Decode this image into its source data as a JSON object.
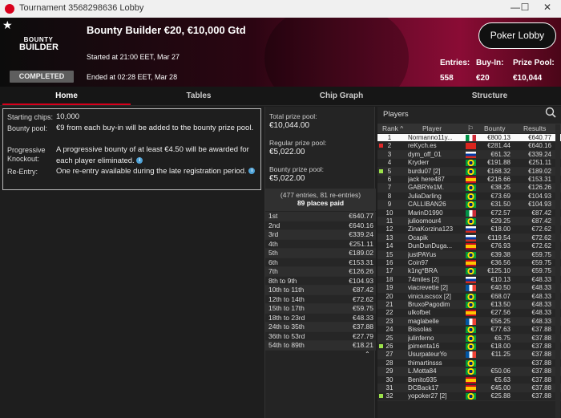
{
  "window": {
    "title": "Tournament 3568298636 Lobby",
    "controls": [
      "—",
      "☐",
      "✕"
    ]
  },
  "header": {
    "logo_line1": "BOUNTY",
    "logo_line2": "BUILDER",
    "title": "Bounty Builder €20, €10,000 Gtd",
    "started": "Started at 21:00 EET, Mar 27",
    "ended": "Ended at 02:28 EET, Mar 28",
    "status": "COMPLETED",
    "lobby_button": "Poker Lobby",
    "entries_label": "Entries:",
    "entries_value": "558",
    "buyin_label": "Buy-In:",
    "buyin_value": "€20",
    "prizepool_label": "Prize Pool:",
    "prizepool_value": "€10,044"
  },
  "tabs": [
    {
      "label": "Home",
      "active": true
    },
    {
      "label": "Tables",
      "active": false
    },
    {
      "label": "Chip Graph",
      "active": false
    },
    {
      "label": "Structure",
      "active": false
    }
  ],
  "info": {
    "chips_label": "Starting chips:",
    "chips_value": "10,000",
    "bounty_label": "Bounty pool:",
    "bounty_value": "€9 from each buy-in will be added to the bounty prize pool.",
    "prog_label1": "Progressive",
    "prog_label2": "Knockout:",
    "prog_value": "A progressive bounty of at least €4.50 will be awarded for each player eliminated.",
    "reentry_label": "Re-Entry:",
    "reentry_value": "One re-entry available during the late registration period."
  },
  "prize": {
    "total_label": "Total prize pool:",
    "total_value": "€10,044.00",
    "regular_label": "Regular prize pool:",
    "regular_value": "€5,022.00",
    "bounty_label": "Bounty prize pool:",
    "bounty_value": "€5,022.00",
    "entries_note": "(477 entries, 81 re-entries)",
    "places_paid": "89 places paid",
    "payouts": [
      {
        "place": "1st",
        "amount": "€640.77"
      },
      {
        "place": "2nd",
        "amount": "€640.16"
      },
      {
        "place": "3rd",
        "amount": "€339.24"
      },
      {
        "place": "4th",
        "amount": "€251.11"
      },
      {
        "place": "5th",
        "amount": "€189.02"
      },
      {
        "place": "6th",
        "amount": "€153.31"
      },
      {
        "place": "7th",
        "amount": "€126.26"
      },
      {
        "place": "8th to 9th",
        "amount": "€104.93"
      },
      {
        "place": "10th to 11th",
        "amount": "€87.42"
      },
      {
        "place": "12th to 14th",
        "amount": "€72.62"
      },
      {
        "place": "15th to 17th",
        "amount": "€59.75"
      },
      {
        "place": "18th to 23rd",
        "amount": "€48.33"
      },
      {
        "place": "24th to 35th",
        "amount": "€37.88"
      },
      {
        "place": "36th to 53rd",
        "amount": "€27.79"
      },
      {
        "place": "54th to 89th",
        "amount": "€18.21"
      }
    ]
  },
  "players": {
    "heading": "Players",
    "columns": {
      "rank": "Rank",
      "player": "Player",
      "bounty": "Bounty",
      "results": "Results"
    },
    "rows": [
      {
        "rank": "1",
        "name": "Normanno11y...",
        "flag": "flag-italy",
        "bounty": "€800.13",
        "result": "€640.77",
        "marker": "none"
      },
      {
        "rank": "2",
        "name": "reKych.es",
        "flag": "flag-vietnam",
        "bounty": "€281.44",
        "result": "€640.16",
        "marker": "red"
      },
      {
        "rank": "3",
        "name": "dym_off_01",
        "flag": "flag-russia",
        "bounty": "€61.32",
        "result": "€339.24",
        "marker": "none"
      },
      {
        "rank": "4",
        "name": "Kryderr",
        "flag": "flag-brazil",
        "bounty": "€191.88",
        "result": "€251.11",
        "marker": "none"
      },
      {
        "rank": "5",
        "name": "burdu07 [2]",
        "flag": "flag-brazil",
        "bounty": "€168.32",
        "result": "€189.02",
        "marker": "green"
      },
      {
        "rank": "6",
        "name": "jack here487",
        "flag": "flag-spain",
        "bounty": "€216.66",
        "result": "€153.31",
        "marker": "none"
      },
      {
        "rank": "7",
        "name": "GABRYe1M.",
        "flag": "flag-brazil",
        "bounty": "€38.25",
        "result": "€126.26",
        "marker": "none"
      },
      {
        "rank": "8",
        "name": "JuliaDarling",
        "flag": "flag-brazil",
        "bounty": "€73.69",
        "result": "€104.93",
        "marker": "none"
      },
      {
        "rank": "9",
        "name": "CALLIBAN26",
        "flag": "flag-brazil",
        "bounty": "€31.50",
        "result": "€104.93",
        "marker": "none"
      },
      {
        "rank": "10",
        "name": "MarinD1990",
        "flag": "flag-italy",
        "bounty": "€72.57",
        "result": "€87.42",
        "marker": "none"
      },
      {
        "rank": "11",
        "name": "julioomour4",
        "flag": "flag-brazil",
        "bounty": "€29.25",
        "result": "€87.42",
        "marker": "none"
      },
      {
        "rank": "12",
        "name": "ZinaKorzina123",
        "flag": "flag-russia",
        "bounty": "€18.00",
        "result": "€72.62",
        "marker": "none"
      },
      {
        "rank": "13",
        "name": "Ocapik",
        "flag": "flag-russia",
        "bounty": "€119.54",
        "result": "€72.62",
        "marker": "none"
      },
      {
        "rank": "14",
        "name": "DunDunDuga...",
        "flag": "flag-spain",
        "bounty": "€76.93",
        "result": "€72.62",
        "marker": "none"
      },
      {
        "rank": "15",
        "name": "justPAYus",
        "flag": "flag-brazil",
        "bounty": "€39.38",
        "result": "€59.75",
        "marker": "none"
      },
      {
        "rank": "16",
        "name": "Coin97",
        "flag": "flag-spain",
        "bounty": "€36.56",
        "result": "€59.75",
        "marker": "none"
      },
      {
        "rank": "17",
        "name": "k1ng*BRA",
        "flag": "flag-brazil",
        "bounty": "€125.10",
        "result": "€59.75",
        "marker": "none"
      },
      {
        "rank": "18",
        "name": "74miles [2]",
        "flag": "flag-russia",
        "bounty": "€10.13",
        "result": "€48.33",
        "marker": "none"
      },
      {
        "rank": "19",
        "name": "viacrevette [2]",
        "flag": "flag-france",
        "bounty": "€40.50",
        "result": "€48.33",
        "marker": "none"
      },
      {
        "rank": "20",
        "name": "viniciuscsox [2]",
        "flag": "flag-brazil",
        "bounty": "€68.07",
        "result": "€48.33",
        "marker": "none"
      },
      {
        "rank": "21",
        "name": "BruxoPagodim",
        "flag": "flag-brazil",
        "bounty": "€13.50",
        "result": "€48.33",
        "marker": "none"
      },
      {
        "rank": "22",
        "name": "ulkofbet",
        "flag": "flag-spain",
        "bounty": "€27.56",
        "result": "€48.33",
        "marker": "none"
      },
      {
        "rank": "23",
        "name": "maglabelle",
        "flag": "flag-france",
        "bounty": "€56.25",
        "result": "€48.33",
        "marker": "none"
      },
      {
        "rank": "24",
        "name": "Bissolas",
        "flag": "flag-brazil",
        "bounty": "€77.63",
        "result": "€37.88",
        "marker": "none"
      },
      {
        "rank": "25",
        "name": "julinferno",
        "flag": "flag-brazil",
        "bounty": "€6.75",
        "result": "€37.88",
        "marker": "none"
      },
      {
        "rank": "26",
        "name": "jpimenta16",
        "flag": "flag-brazil",
        "bounty": "€18.00",
        "result": "€37.88",
        "marker": "green"
      },
      {
        "rank": "27",
        "name": "UsurpateurYo",
        "flag": "flag-france",
        "bounty": "€11.25",
        "result": "€37.88",
        "marker": "none"
      },
      {
        "rank": "28",
        "name": "thimartinsss",
        "flag": "flag-brazil",
        "bounty": "",
        "result": "€37.88",
        "marker": "none"
      },
      {
        "rank": "29",
        "name": "L.Motta84",
        "flag": "flag-brazil",
        "bounty": "€50.06",
        "result": "€37.88",
        "marker": "none"
      },
      {
        "rank": "30",
        "name": "Benito935",
        "flag": "flag-spain",
        "bounty": "€5.63",
        "result": "€37.88",
        "marker": "none"
      },
      {
        "rank": "31",
        "name": "DCBack17",
        "flag": "flag-spain",
        "bounty": "€45.00",
        "result": "€37.88",
        "marker": "none"
      },
      {
        "rank": "32",
        "name": "yopoker27 [2]",
        "flag": "flag-brazil",
        "bounty": "€25.88",
        "result": "€37.88",
        "marker": "green"
      }
    ]
  },
  "colors": {
    "accent": "#d9001c",
    "header_red": "#8a0c35",
    "marker_green": "#9be14a",
    "marker_red": "#e02a2a",
    "info_icon": "#4fa3d8"
  }
}
